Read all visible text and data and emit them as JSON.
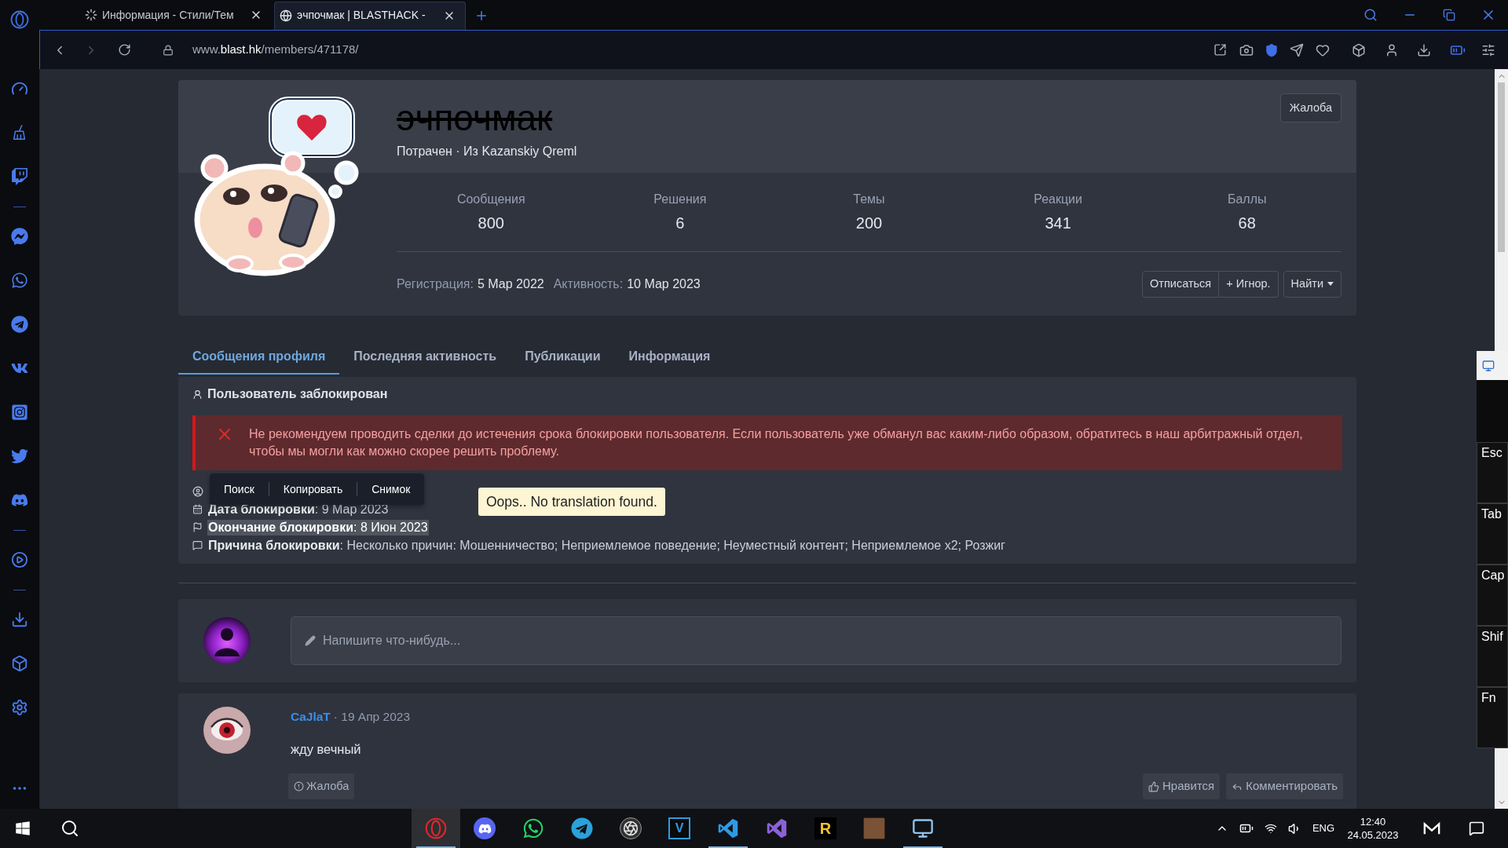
{
  "browser": {
    "tabs": [
      {
        "title": "Информация - Стили/Тем",
        "selected": false,
        "loading": true
      },
      {
        "title": "эчпочмак | BLASTHACK -",
        "selected": true,
        "loading": false
      }
    ],
    "url": "www.**blast.hk**/members/471178/"
  },
  "profile": {
    "username": "эчпочмак",
    "banned": true,
    "subtitle": "Потрачен · Из Kazanskiy Qreml",
    "report_button": "Жалоба",
    "stats": [
      {
        "label": "Сообщения",
        "value": "800"
      },
      {
        "label": "Решения",
        "value": "6"
      },
      {
        "label": "Темы",
        "value": "200"
      },
      {
        "label": "Реакции",
        "value": "341"
      },
      {
        "label": "Баллы",
        "value": "68"
      }
    ],
    "registration_label": "Регистрация:",
    "registration": "5 Мар 2022",
    "activity_label": "Активность:",
    "activity": "10 Мар 2023",
    "buttons": [
      "Отписаться",
      "+ Игнор."
    ],
    "find_button": "Найти"
  },
  "tabs": [
    {
      "label": "Сообщения профиля",
      "selected": true
    },
    {
      "label": "Последняя активность",
      "selected": false
    },
    {
      "label": "Публикации",
      "selected": false
    },
    {
      "label": "Информация",
      "selected": false
    }
  ],
  "ban_notice": {
    "title": "Пользователь заблокирован",
    "warning": "Не рекомендуем проводить сделки до истечения срока блокировки пользователя. Если пользователь уже обманул вас каким-либо образом, обратитесь в наш арбитражный отдел, чтобы мы могли как можно скорее решить проблему.",
    "details": [
      {
        "text": "**Дата блокировки**: 9 Мар 2023",
        "highlighted": false
      },
      {
        "text": "**Окончание блокировки**: 8 Июн 2023",
        "highlighted": true
      },
      {
        "text": "**Причина блокировки**: Несколько причин: Мошенничество; Неприемлемое поведение; Неуместный контент; Неприемлемое x2; Розжиг",
        "highlighted": false
      }
    ]
  },
  "selection_menu": [
    "Поиск",
    "Копировать",
    "Снимок"
  ],
  "translation_tooltip": "Oops.. No translation found.",
  "composer": {
    "placeholder": "Напишите что-нибудь..."
  },
  "posts": [
    {
      "author": "CaJlaT",
      "meta": "· 19 Апр 2023",
      "text": "жду вечный",
      "report": "Жалоба",
      "like": "Нравится",
      "comment": "Комментировать"
    }
  ],
  "onscreen_keyboard": {
    "keys": [
      "Esc",
      "Tab",
      "Cap",
      "Shif",
      "Fn"
    ]
  },
  "taskbar": {
    "apps": [
      {
        "active": true,
        "running": true
      },
      {
        "active": false,
        "running": false
      },
      {
        "active": false,
        "running": false
      },
      {
        "active": false,
        "running": false
      },
      {
        "active": false,
        "running": false
      },
      {
        "label": "V",
        "active": false,
        "running": false
      },
      {
        "active": false,
        "running": true
      },
      {
        "active": false,
        "running": false
      },
      {
        "label": "R",
        "active": false,
        "running": false
      },
      {
        "active": false,
        "running": false
      },
      {
        "active": false,
        "running": true
      }
    ],
    "language": "ENG",
    "time": "12:40",
    "date": "24.05.2023"
  }
}
